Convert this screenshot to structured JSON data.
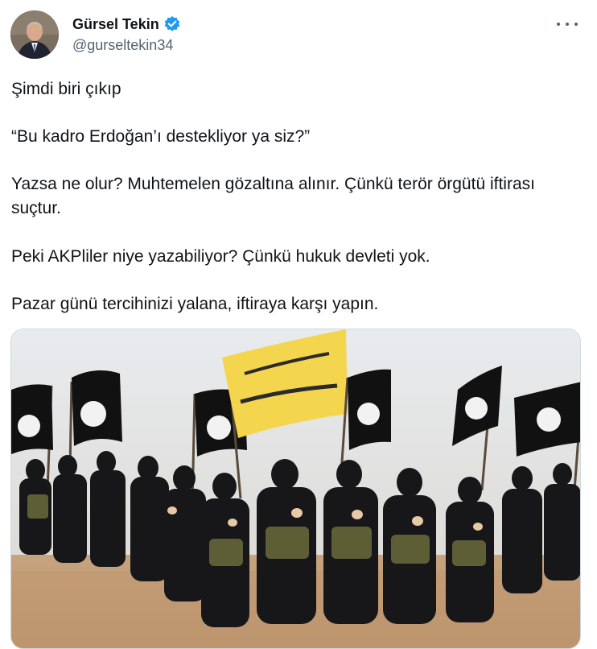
{
  "author": {
    "display_name": "Gürsel Tekin",
    "handle": "@gurseltekin34",
    "verified_icon": "verified-badge-icon",
    "avatar_icon": "user-avatar"
  },
  "menu": {
    "icon": "more-horizontal-icon"
  },
  "tweet": {
    "paragraphs": [
      "Şimdi biri çıkıp",
      "“Bu kadro Erdoğan’ı destekliyor ya siz?”",
      "Yazsa ne olur? Muhtemelen gözaltına alınır. Çünkü terör örgütü iftirası suçtur.",
      "Peki AKPliler niye yazabiliyor? Çünkü hukuk devleti yok.",
      "Pazar günü tercihinizi yalana, iftiraya karşı yapın."
    ]
  },
  "media": {
    "kind": "photo",
    "colors": {
      "sky": "#e9ecef",
      "ground": "#c9a57e",
      "flag_black": "#111111",
      "flag_yellow": "#f3d54e"
    }
  },
  "colors": {
    "text": "#0f1419",
    "secondary": "#536471",
    "verified": "#1d9bf0",
    "border": "#cfd9de"
  }
}
